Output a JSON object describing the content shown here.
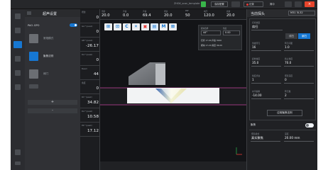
{
  "window": {
    "title": "ZHGK_scan_template",
    "save_button": "保存配置",
    "record_button": "记录",
    "language": "简中",
    "close_icon": "×"
  },
  "settings_panel": {
    "title": "超声设置",
    "pao_label": "PAO-GPO",
    "items": [
      {
        "label": "常规模式",
        "icon": "pause-icon"
      },
      {
        "label": "聚焦法则",
        "icon": "probe-icon"
      },
      {
        "label": "阈门",
        "icon": "gate-icon"
      },
      {
        "label": "",
        "icon": "grid-icon"
      }
    ],
    "plus_label": "+",
    "minus_label": "-"
  },
  "readouts": [
    {
      "label": "增益",
      "value": "0"
    },
    {
      "label": "GA^(peak)",
      "value": "0"
    },
    {
      "label": "GB^(peak)",
      "value": "-26.17"
    },
    {
      "label": "DA^(peak)",
      "value": "0"
    },
    {
      "label": "Beam",
      "value": "44"
    },
    {
      "label": "角度",
      "value": "0"
    },
    {
      "label": "PA^(peak)",
      "value": "34.82"
    },
    {
      "label": "DA^(peak)",
      "value": "10.58"
    },
    {
      "label": "PR^(peak)",
      "value": "17.12"
    }
  ],
  "parameter_strip": [
    {
      "label": "范围",
      "value": "20.0"
    },
    {
      "label": "声速",
      "value": "0.0"
    },
    {
      "label": "声速",
      "value": "69.4"
    },
    {
      "label": "增益",
      "value": "20.0"
    },
    {
      "label": "PRF",
      "value": "50"
    },
    {
      "label": "电压",
      "value": "120.0"
    },
    {
      "label": "滤波",
      "value": "20.0"
    }
  ],
  "viewport": {
    "toolbar": [
      "⊞",
      "⊡",
      "C",
      "✕",
      "▣",
      "▤",
      "M",
      "⊠"
    ],
    "overlay": {
      "wedge_label": "楔块选择",
      "angle_label": "角度",
      "angle_value": "44°",
      "position_label": "前沿",
      "position_value": "0.00",
      "line1": "扫查  17.00  声速  3240",
      "line2": "楔块  17.20  角度  36.00"
    }
  },
  "right_panel": {
    "title": "当前探头",
    "probe_select": "M31 5L32",
    "field_type_label": "扫查类型",
    "field_type_value": "扇扫",
    "seg_off": "线扫",
    "seg_on": "扇扫",
    "fields": [
      {
        "label": "激发阵元",
        "value": "16"
      },
      {
        "label": "阵元间距",
        "value": "1.0"
      },
      {
        "label": "起始角度",
        "value": "35.0"
      },
      {
        "label": "终止角度",
        "value": "70.0"
      },
      {
        "label": "角度步进",
        "value": "1"
      },
      {
        "label": "聚焦深度",
        "value": "0"
      },
      {
        "label": "水平偏移",
        "value": "-14.00"
      },
      {
        "label": "阵元数",
        "value": "2"
      }
    ],
    "apply_button": "应用聚焦法则",
    "section2_title": "聚焦",
    "mode_label": "聚焦模式",
    "mode_value": "真实聚焦",
    "depth_label": "深度",
    "depth_value": "20.00 mm"
  }
}
